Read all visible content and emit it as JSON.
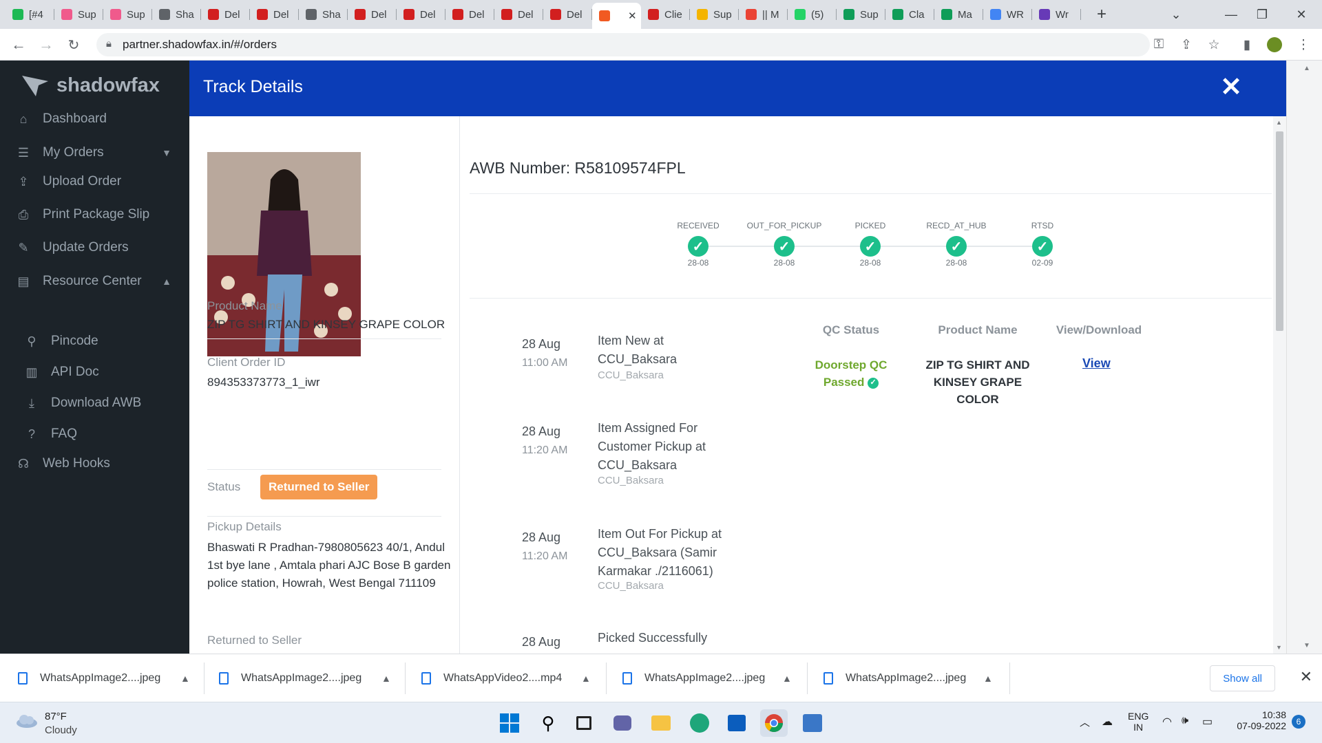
{
  "browser": {
    "tabs": [
      {
        "label": "[#4",
        "color": "#1db954"
      },
      {
        "label": "Sup",
        "color": "#f05a8c"
      },
      {
        "label": "Sup",
        "color": "#f05a8c"
      },
      {
        "label": "Sha",
        "color": "#5f6368"
      },
      {
        "label": "Del",
        "color": "#d21f1f"
      },
      {
        "label": "Del",
        "color": "#d21f1f"
      },
      {
        "label": "Sha",
        "color": "#5f6368"
      },
      {
        "label": "Del",
        "color": "#d21f1f"
      },
      {
        "label": "Del",
        "color": "#d21f1f"
      },
      {
        "label": "Del",
        "color": "#d21f1f"
      },
      {
        "label": "Del",
        "color": "#d21f1f"
      },
      {
        "label": "Del",
        "color": "#d21f1f"
      },
      {
        "label": "",
        "color": "#f15a22"
      },
      {
        "label": "Clie",
        "color": "#d21f1f"
      },
      {
        "label": "Sup",
        "color": "#f4b400"
      },
      {
        "label": "|| M",
        "color": "#ea4335"
      },
      {
        "label": "(5)",
        "color": "#25d366"
      },
      {
        "label": "Sup",
        "color": "#0f9d58"
      },
      {
        "label": "Cla",
        "color": "#0f9d58"
      },
      {
        "label": "Ma",
        "color": "#0f9d58"
      },
      {
        "label": "WR",
        "color": "#4285f4"
      },
      {
        "label": "Wr",
        "color": "#673ab7"
      }
    ],
    "url": "partner.shadowfax.in/#/orders"
  },
  "sidebar": {
    "brand": "shadowfax",
    "items": [
      {
        "label": "Dashboard",
        "icon": "home-icon"
      },
      {
        "label": "My Orders",
        "icon": "list-icon"
      },
      {
        "label": "Upload Order",
        "icon": "upload-icon"
      },
      {
        "label": "Print Package Slip",
        "icon": "print-icon"
      },
      {
        "label": "Update Orders",
        "icon": "edit-icon"
      },
      {
        "label": "Resource Center",
        "icon": "book-icon"
      },
      {
        "label": "Pincode",
        "icon": "map-marker-icon"
      },
      {
        "label": "API Doc",
        "icon": "file-icon"
      },
      {
        "label": "Download AWB",
        "icon": "download-icon"
      },
      {
        "label": "FAQ",
        "icon": "question-icon"
      },
      {
        "label": "Web Hooks",
        "icon": "rss-icon"
      }
    ]
  },
  "modal": {
    "title": "Track Details",
    "product_name_label": "Product Name",
    "product_name": "ZIP TG SHIRT AND KINSEY GRAPE COLOR",
    "client_order_label": "Client Order ID",
    "client_order_id": "894353373773_1_iwr",
    "status_label": "Status",
    "status": "Returned to Seller",
    "pickup_label": "Pickup Details",
    "pickup_details": "Bhaswati R Pradhan-7980805623 40/1, Andul 1st bye lane , Amtala phari AJC Bose B garden police station, Howrah, West Bengal 711109",
    "rts_label": "Returned to Seller",
    "awb": "AWB Number: R58109574FPL",
    "steps": [
      {
        "name": "RECEIVED",
        "date": "28-08"
      },
      {
        "name": "OUT_FOR_PICKUP",
        "date": "28-08"
      },
      {
        "name": "PICKED",
        "date": "28-08"
      },
      {
        "name": "RECD_AT_HUB",
        "date": "28-08"
      },
      {
        "name": "RTSD",
        "date": "02-09"
      }
    ],
    "events": [
      {
        "date": "28 Aug",
        "time": "11:00 AM",
        "title": "Item New at CCU_Baksara",
        "loc": "CCU_Baksara"
      },
      {
        "date": "28 Aug",
        "time": "11:20 AM",
        "title": "Item Assigned For Customer Pickup at CCU_Baksara",
        "loc": "CCU_Baksara"
      },
      {
        "date": "28 Aug",
        "time": "11:20 AM",
        "title": "Item Out For Pickup at CCU_Baksara (Samir Karmakar ./2116061)",
        "loc": "CCU_Baksara"
      },
      {
        "date": "28 Aug",
        "time": "",
        "title": "Picked Successfully",
        "loc": ""
      }
    ],
    "qc_header": "QC Status",
    "pn_header": "Product Name",
    "vd_header": "View/Download",
    "qc_value": "Doorstep QC Passed",
    "pn_value": "ZIP TG SHIRT AND KINSEY GRAPE COLOR",
    "view_label": "View"
  },
  "downloads": {
    "items": [
      "WhatsAppImage2....jpeg",
      "WhatsAppImage2....jpeg",
      "WhatsAppVideo2....mp4",
      "WhatsAppImage2....jpeg",
      "WhatsAppImage2....jpeg"
    ],
    "show_all": "Show all"
  },
  "taskbar": {
    "temp": "87°F",
    "weather": "Cloudy",
    "lang1": "ENG",
    "lang2": "IN",
    "time": "10:38",
    "date": "07-09-2022",
    "notif": "6"
  },
  "colors": {
    "brand_blue": "#0b3db7",
    "sidebar_bg": "#1c2329",
    "status_orange": "#f59b50",
    "check_green": "#1dbf8b"
  }
}
